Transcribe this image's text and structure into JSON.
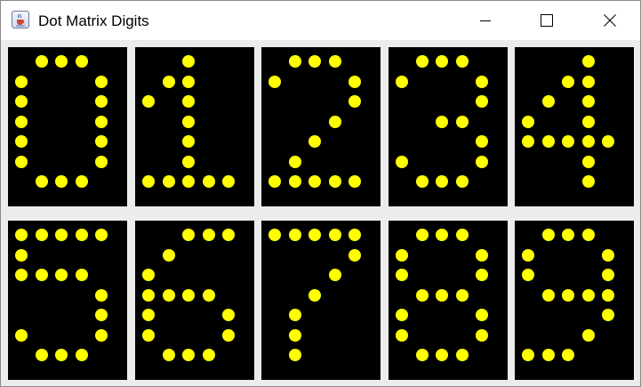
{
  "window": {
    "title": "Dot Matrix Digits",
    "icon": "java-cup-icon",
    "controls": [
      "minimize-icon",
      "maximize-icon",
      "close-icon"
    ]
  },
  "colors": {
    "background": "#ececec",
    "panel": "#000000",
    "dot": "#ffff00"
  },
  "matrix": {
    "columns": 5,
    "rows": 7
  },
  "digits": [
    {
      "digit": 0,
      "rows": [
        "01110",
        "10001",
        "10001",
        "10001",
        "10001",
        "10001",
        "01110"
      ]
    },
    {
      "digit": 1,
      "rows": [
        "00100",
        "01100",
        "10100",
        "00100",
        "00100",
        "00100",
        "11111"
      ]
    },
    {
      "digit": 2,
      "rows": [
        "01110",
        "10001",
        "00001",
        "00010",
        "00100",
        "01000",
        "11111"
      ]
    },
    {
      "digit": 3,
      "rows": [
        "01110",
        "10001",
        "00001",
        "00110",
        "00001",
        "10001",
        "01110"
      ]
    },
    {
      "digit": 4,
      "rows": [
        "00010",
        "00110",
        "01010",
        "10010",
        "11111",
        "00010",
        "00010"
      ]
    },
    {
      "digit": 5,
      "rows": [
        "11111",
        "10000",
        "11110",
        "00001",
        "00001",
        "10001",
        "01110"
      ]
    },
    {
      "digit": 6,
      "rows": [
        "00111",
        "01000",
        "10000",
        "11110",
        "10001",
        "10001",
        "01110"
      ]
    },
    {
      "digit": 7,
      "rows": [
        "11111",
        "00001",
        "00010",
        "00100",
        "01000",
        "01000",
        "01000"
      ]
    },
    {
      "digit": 8,
      "rows": [
        "01110",
        "10001",
        "10001",
        "01110",
        "10001",
        "10001",
        "01110"
      ]
    },
    {
      "digit": 9,
      "rows": [
        "01110",
        "10001",
        "10001",
        "01111",
        "00001",
        "00010",
        "11100"
      ]
    }
  ]
}
